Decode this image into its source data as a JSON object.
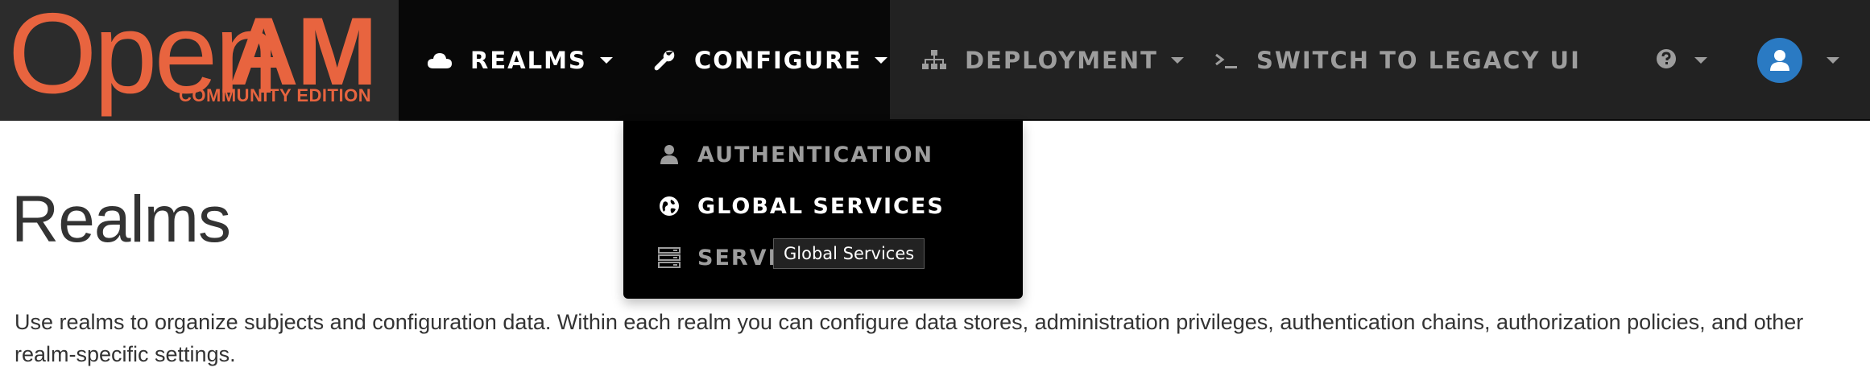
{
  "brand": {
    "name_light": "Open",
    "name_bold": "AM",
    "edition": "COMMUNITY EDITION",
    "color": "#e8643f"
  },
  "navbar": {
    "items": [
      {
        "label": "REALMS",
        "icon": "cloud-icon"
      },
      {
        "label": "CONFIGURE",
        "icon": "wrench-icon"
      },
      {
        "label": "DEPLOYMENT",
        "icon": "sitemap-icon"
      },
      {
        "label": "SWITCH TO LEGACY UI",
        "icon": "terminal-icon"
      }
    ],
    "help_icon": "question-circle-icon",
    "user_icon": "user-icon",
    "avatar_color": "#2a7ac3"
  },
  "configure_menu": {
    "items": [
      {
        "label": "AUTHENTICATION",
        "icon": "user-icon"
      },
      {
        "label": "GLOBAL SERVICES",
        "icon": "globe-icon"
      },
      {
        "label": "SERVE",
        "icon": "server-icon"
      }
    ]
  },
  "tooltip": {
    "text": "Global Services"
  },
  "page": {
    "title": "Realms",
    "description": "Use realms to organize subjects and configuration data. Within each realm you can configure data stores, administration privileges, authentication chains, authorization policies, and other realm-specific settings."
  }
}
